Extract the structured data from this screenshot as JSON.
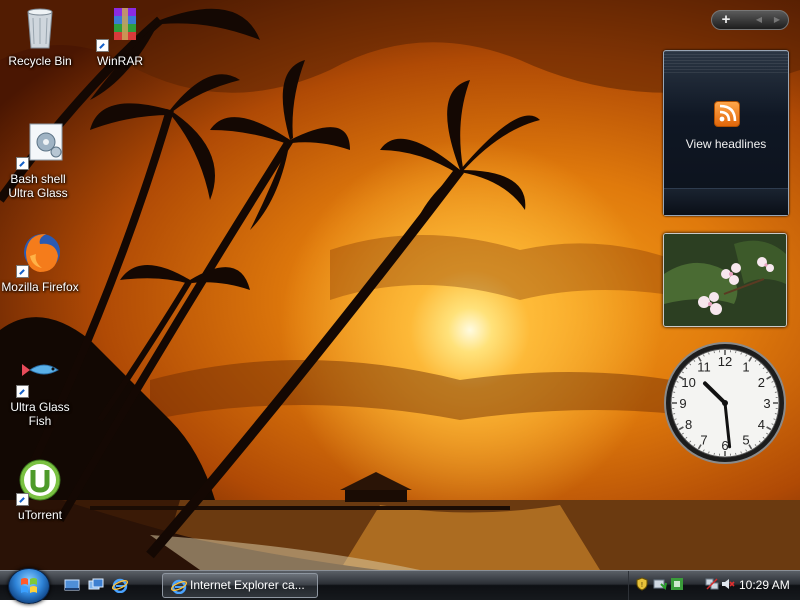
{
  "desktop": {
    "icons": [
      {
        "label": "Recycle Bin",
        "icon": "recycle-bin-icon"
      },
      {
        "label": "WinRAR",
        "icon": "winrar-icon"
      },
      {
        "label": "Bash shell Ultra Glass",
        "icon": "bash-shell-icon"
      },
      {
        "label": "Mozilla Firefox",
        "icon": "firefox-icon"
      },
      {
        "label": "Ultra Glass Fish",
        "icon": "fish-icon"
      },
      {
        "label": "uTorrent",
        "icon": "utorrent-icon"
      }
    ]
  },
  "sidebar": {
    "controls": {
      "add": "+",
      "prev": "◀",
      "next": "▶"
    },
    "feed_gadget": {
      "label": "View headlines",
      "icon": "rss-icon"
    },
    "slideshow_gadget": {
      "subject": "plumeria flowers"
    },
    "clock_gadget": {
      "numbers": [
        "12",
        "1",
        "2",
        "3",
        "4",
        "5",
        "6",
        "7",
        "8",
        "9",
        "10",
        "11"
      ],
      "time": {
        "hour": 10,
        "minute": 29
      }
    }
  },
  "taskbar": {
    "start_button": "start-orb",
    "quick_launch": [
      "show-desktop-icon",
      "switch-windows-icon",
      "internet-explorer-icon"
    ],
    "tasks": [
      {
        "label": "Internet Explorer ca...",
        "icon": "internet-explorer-icon"
      }
    ],
    "tray": {
      "icons": [
        "security-shield-icon",
        "network-status-icon",
        "windows-defender-icon",
        "network-icon",
        "volume-muted-icon"
      ],
      "clock": "10:29 AM"
    }
  },
  "colors": {
    "sky_glow": "#f7a21c",
    "sun": "#fff4b8",
    "gadget_dark": "#0f1724",
    "taskbar": "#16191d",
    "rss_orange": "#f08a24"
  }
}
